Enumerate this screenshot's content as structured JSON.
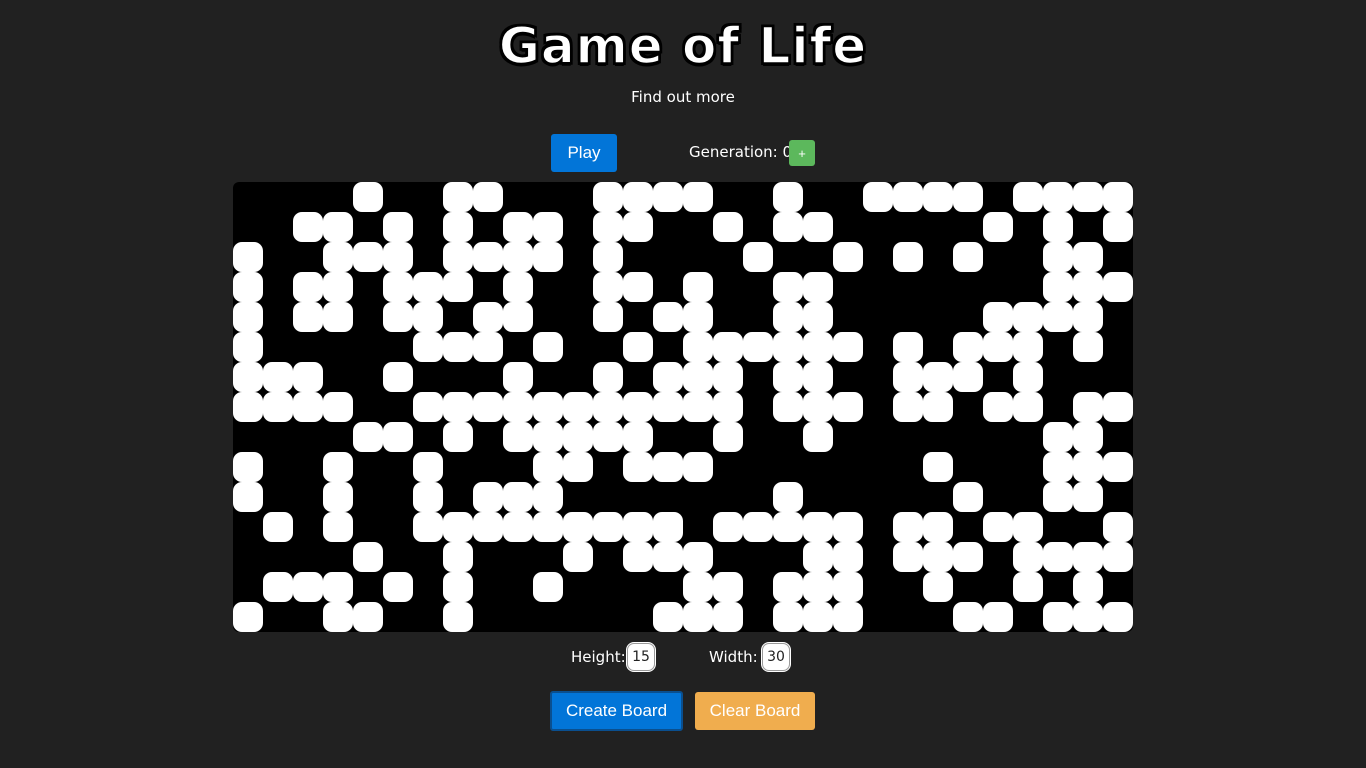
{
  "header": {
    "title": "Game of Life",
    "link": "Find out more"
  },
  "controls": {
    "play_label": "Play",
    "generation_label": "Generation:",
    "generation_value": "0",
    "step_label": "+"
  },
  "board": {
    "rows": 15,
    "cols": 30,
    "alive_color": "#ffffff",
    "dead_color": "#000000",
    "cells": [
      "....#..##...####..#..####.####",
      "..##.#.#.##.##..#.##.....#.#.#",
      "#..###.####.#....#..#.#.#..##.#",
      "#.##.###.#..##.#..##.......####",
      "#.##.##.##..#.##..##.....####.",
      "#.....###.#..#.######.#.###.#.#",
      "###..#...#..#.###.##..###.#...",
      "####..###########.###.##.##.####",
      "....##.#.#####..#..#.......##.#",
      "#..#..#...##.###.......#...###",
      "#..#..#.###.......#.....#..##.#",
      ".#.#..#########.#####.##.##..#.#",
      "....#..#...#.###...##.###.####.#",
      ".###.#.#..#....##.###..#..#.#.#",
      "#..##..#......###.###...##.###."
    ]
  },
  "settings": {
    "height_label": "Height:",
    "height_value": "15",
    "width_label": "Width:",
    "width_value": "30"
  },
  "actions": {
    "create_label": "Create Board",
    "clear_label": "Clear Board"
  }
}
